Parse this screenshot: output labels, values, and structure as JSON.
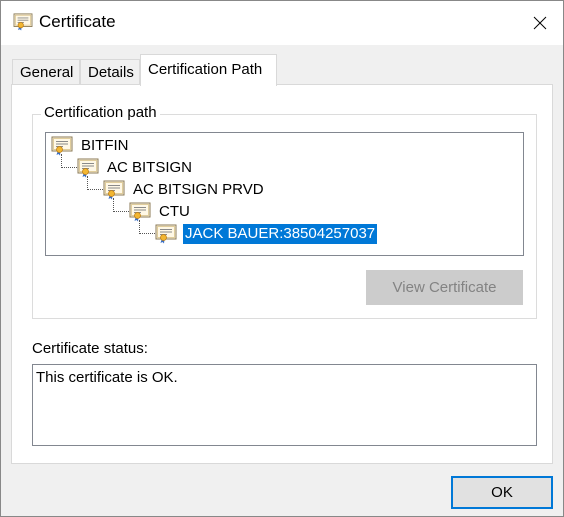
{
  "window": {
    "title": "Certificate",
    "close_label": "✕"
  },
  "tabs": [
    {
      "label": "General",
      "active": false
    },
    {
      "label": "Details",
      "active": false
    },
    {
      "label": "Certification Path",
      "active": true
    }
  ],
  "cert_path": {
    "group_label": "Certification path",
    "items": [
      {
        "label": "BITFIN",
        "level": 0,
        "selected": false
      },
      {
        "label": "AC BITSIGN",
        "level": 1,
        "selected": false
      },
      {
        "label": "AC BITSIGN PRVD",
        "level": 2,
        "selected": false
      },
      {
        "label": "CTU",
        "level": 3,
        "selected": false
      },
      {
        "label": "JACK BAUER:38504257037",
        "level": 4,
        "selected": true
      }
    ],
    "view_button_label": "View Certificate",
    "view_button_enabled": false
  },
  "status": {
    "label": "Certificate status:",
    "text": "This certificate is OK."
  },
  "footer": {
    "ok_label": "OK"
  },
  "colors": {
    "selection": "#0078d7",
    "focus_border": "#0078d7",
    "disabled_button": "#cccccc"
  },
  "icons": {
    "title": "certificate-icon",
    "tree_item": "certificate-icon",
    "close": "close-icon"
  }
}
